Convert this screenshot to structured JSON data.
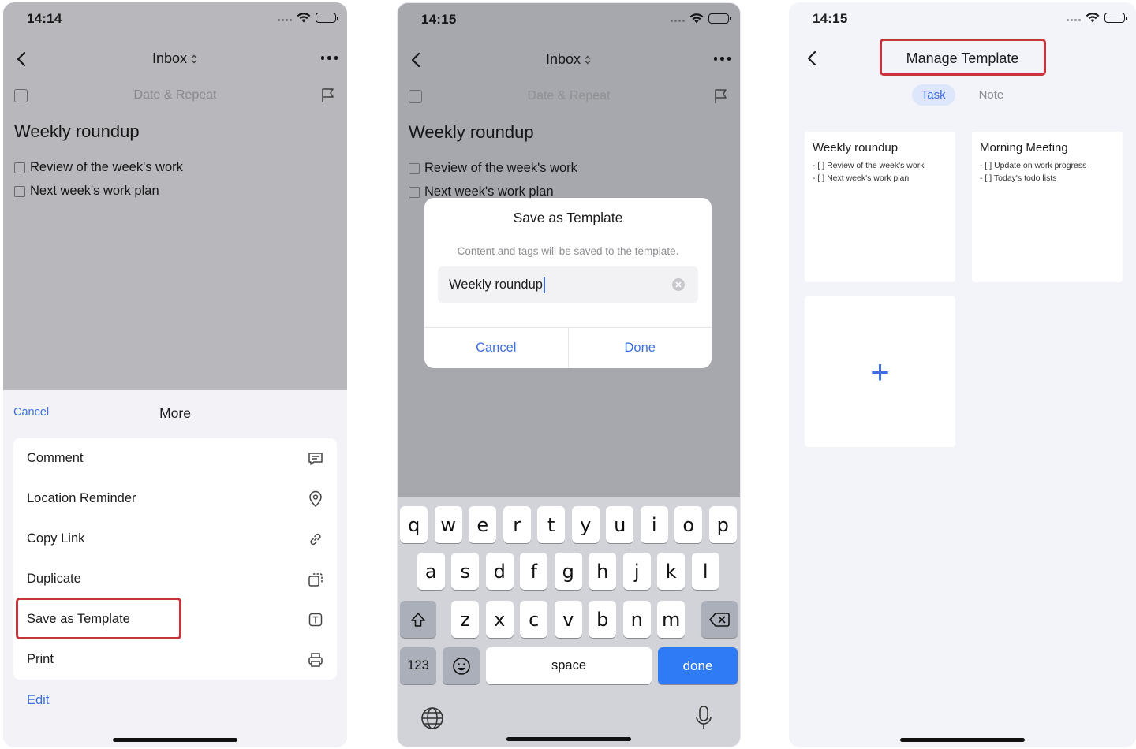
{
  "common": {
    "list_name": "Inbox",
    "date_placeholder": "Date & Repeat",
    "task_title": "Weekly roundup",
    "subtasks": [
      "Review of the week's work",
      "Next week's work plan"
    ]
  },
  "screen1": {
    "time": "14:14",
    "sheet": {
      "cancel": "Cancel",
      "title": "More",
      "items": [
        {
          "label": "Comment",
          "icon": "comment-icon"
        },
        {
          "label": "Location Reminder",
          "icon": "location-pin-icon"
        },
        {
          "label": "Copy Link",
          "icon": "link-icon"
        },
        {
          "label": "Duplicate",
          "icon": "duplicate-icon"
        },
        {
          "label": "Save as Template",
          "icon": "template-icon"
        },
        {
          "label": "Print",
          "icon": "printer-icon"
        }
      ],
      "edit": "Edit"
    }
  },
  "screen2": {
    "time": "14:15",
    "dialog": {
      "title": "Save as Template",
      "message": "Content and tags will be saved to the template.",
      "input_value": "Weekly roundup",
      "cancel": "Cancel",
      "done": "Done"
    },
    "keyboard": {
      "row1": [
        "q",
        "w",
        "e",
        "r",
        "t",
        "y",
        "u",
        "i",
        "o",
        "p"
      ],
      "row2": [
        "a",
        "s",
        "d",
        "f",
        "g",
        "h",
        "j",
        "k",
        "l"
      ],
      "row3": [
        "z",
        "x",
        "c",
        "v",
        "b",
        "n",
        "m"
      ],
      "numbers": "123",
      "space": "space",
      "done": "done"
    }
  },
  "screen3": {
    "time": "14:15",
    "title": "Manage Template",
    "tabs": [
      "Task",
      "Note"
    ],
    "templates": [
      {
        "title": "Weekly roundup",
        "lines": [
          "- [ ]  Review of the week's work",
          "- [ ]  Next week's work plan"
        ]
      },
      {
        "title": "Morning Meeting",
        "lines": [
          "- [ ] Update on work progress",
          "- [ ]  Today's todo lists"
        ]
      }
    ],
    "add_glyph": "+"
  },
  "colors": {
    "accent": "#3d6fe3",
    "highlight": "#c8343c",
    "keyboard_done": "#2f7bf5"
  }
}
